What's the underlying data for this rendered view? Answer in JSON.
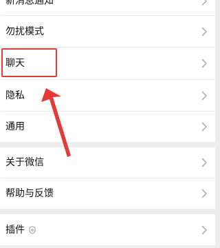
{
  "settings": {
    "items": [
      {
        "label": "新消息通知",
        "icon": "chevron-right-icon"
      },
      {
        "label": "勿扰模式",
        "icon": "chevron-right-icon"
      },
      {
        "label": "聊天",
        "icon": "chevron-right-icon"
      },
      {
        "label": "隐私",
        "icon": "chevron-right-icon"
      },
      {
        "label": "通用",
        "icon": "chevron-right-icon"
      },
      {
        "label": "关于微信",
        "icon": "chevron-right-icon"
      },
      {
        "label": "帮助与反馈",
        "icon": "chevron-right-icon"
      },
      {
        "label": "插件",
        "icon": "chevron-right-icon",
        "badge_icon": "shield-icon"
      }
    ]
  },
  "annotation": {
    "highlight_color": "#e53935",
    "arrow_color": "#e53935"
  }
}
